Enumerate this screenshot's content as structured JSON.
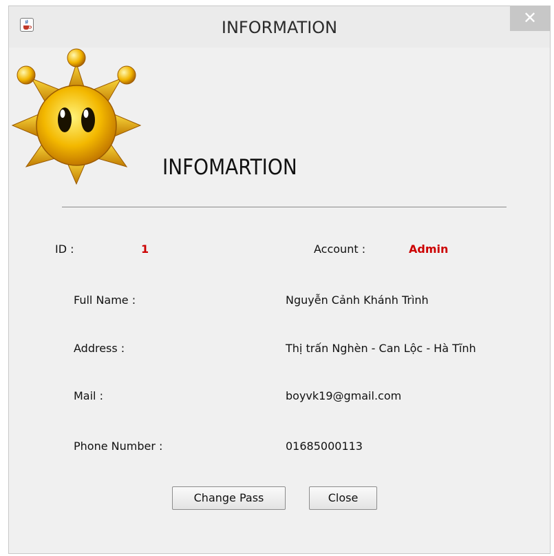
{
  "window": {
    "title": "INFORMATION",
    "close_glyph": "✕"
  },
  "icons": {
    "app": "java-coffee-icon",
    "logo": "sun-mascot-icon"
  },
  "colors": {
    "accent_value": "#cc0000"
  },
  "heading": "INFOMARTION",
  "fields": {
    "id_label": "ID :",
    "id_value": "1",
    "account_label": "Account :",
    "account_value": "Admin",
    "full_name_label": "Full Name :",
    "full_name_value": "Nguyễn Cảnh Khánh Trình",
    "address_label": "Address :",
    "address_value": "Thị trấn Nghèn - Can Lộc - Hà Tĩnh",
    "mail_label": "Mail :",
    "mail_value": "boyvk19@gmail.com",
    "phone_label": "Phone Number :",
    "phone_value": "01685000113"
  },
  "buttons": {
    "change_pass": "Change Pass",
    "close": "Close"
  }
}
